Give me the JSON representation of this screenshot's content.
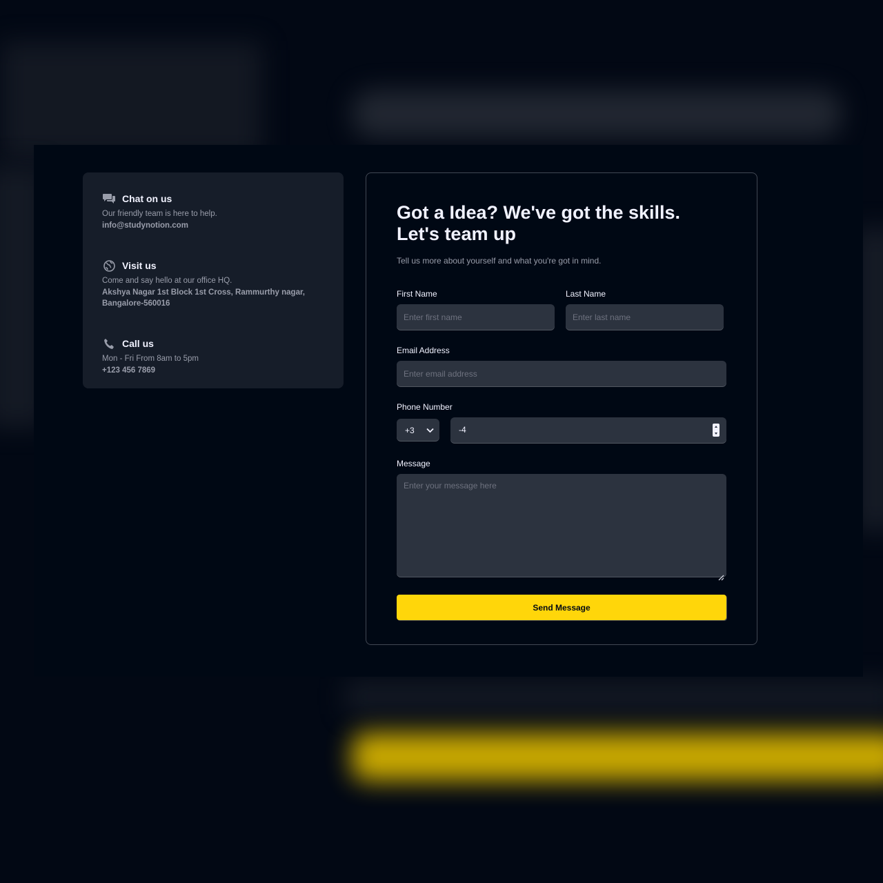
{
  "contact_info": [
    {
      "icon": "chat-icon",
      "title": "Chat on us",
      "description": "Our friendly team is here to help.",
      "detail": "info@studynotion.com"
    },
    {
      "icon": "globe-icon",
      "title": "Visit us",
      "description": "Come and say hello at our office HQ.",
      "detail": "Akshya Nagar 1st Block 1st Cross, Rammurthy nagar, Bangalore-560016"
    },
    {
      "icon": "phone-icon",
      "title": "Call us",
      "description": "Mon - Fri From 8am to 5pm",
      "detail": "+123 456 7869"
    }
  ],
  "form": {
    "title": "Got a Idea? We've got the skills. Let's team up",
    "subtitle": "Tell us more about yourself and what you're got in mind.",
    "first_name": {
      "label": "First Name",
      "placeholder": "Enter first name",
      "value": ""
    },
    "last_name": {
      "label": "Last Name",
      "placeholder": "Enter last name",
      "value": ""
    },
    "email": {
      "label": "Email Address",
      "placeholder": "Enter email address",
      "value": ""
    },
    "phone": {
      "label": "Phone Number",
      "country_code": "+3",
      "value": "-4"
    },
    "message": {
      "label": "Message",
      "placeholder": "Enter your message here",
      "value": ""
    },
    "submit_label": "Send Message"
  },
  "colors": {
    "page_bg": "#000814",
    "card_bg": "#161d29",
    "input_bg": "#2c333f",
    "accent_yellow": "#ffd60a",
    "text_primary": "#f1f2ff",
    "text_muted": "#999daa"
  }
}
